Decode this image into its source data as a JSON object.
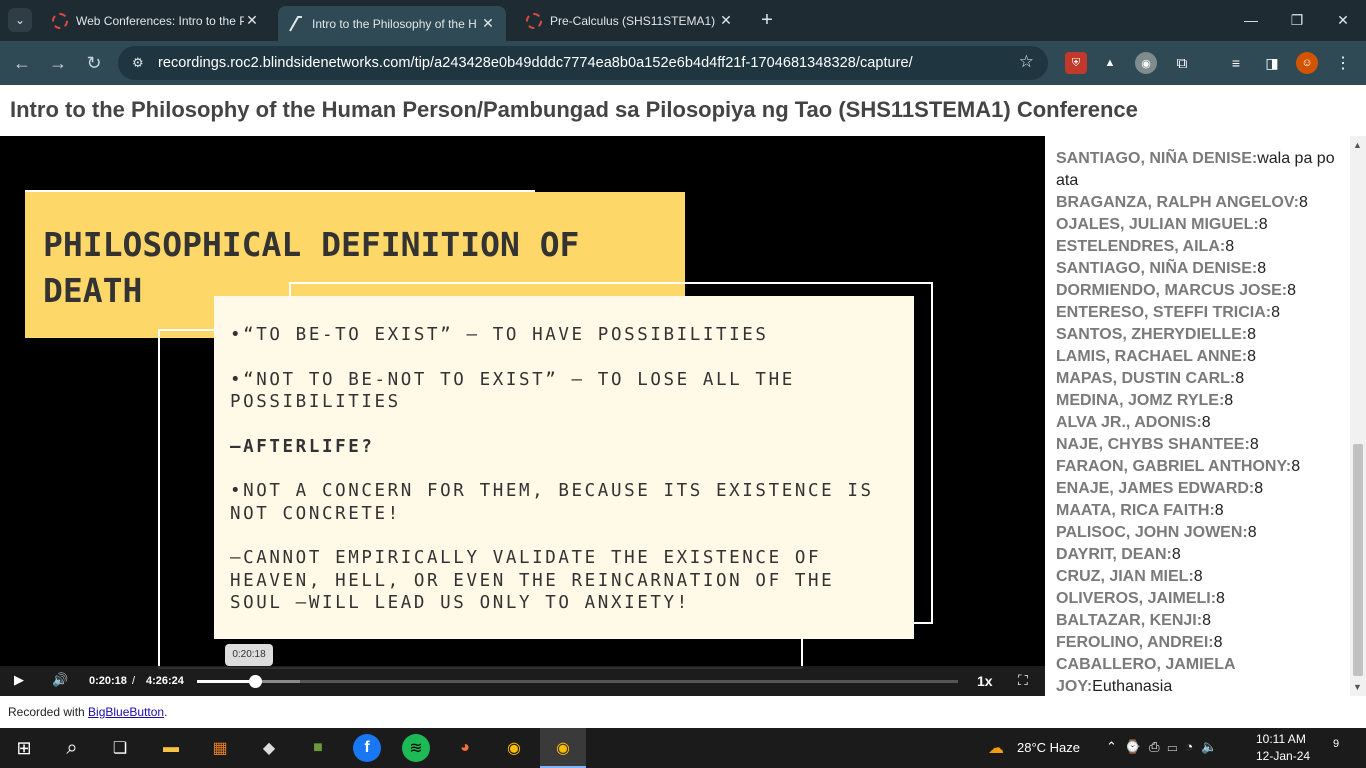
{
  "browser": {
    "tabs": [
      {
        "title": "Web Conferences: Intro to the P",
        "active": false
      },
      {
        "title": "Intro to the Philosophy of the H",
        "active": true
      },
      {
        "title": "Pre-Calculus (SHS11STEMA1)",
        "active": false
      }
    ],
    "url": "recordings.roc2.blindsidenetworks.com/tip/a243428e0b49dddc7774ea8b0a152e6b4d4ff21f-1704681348328/capture/"
  },
  "page": {
    "heading": "Intro to the Philosophy of the Human Person/Pambungad sa Pilosopiya ng Tao (SHS11STEMA1) Conference",
    "footer_prefix": "Recorded with ",
    "footer_link": "BigBlueButton",
    "footer_suffix": "."
  },
  "slide": {
    "title": "PHILOSOPHICAL DEFINITION OF DEATH",
    "lines": [
      "•“TO BE-TO EXIST” – TO HAVE POSSIBILITIES",
      "•“NOT TO BE-NOT TO EXIST” – TO LOSE ALL THE POSSIBILITIES",
      "–AFTERLIFE?",
      "•NOT A CONCERN FOR THEM, BECAUSE ITS EXISTENCE IS NOT CONCRETE!",
      "–CANNOT EMPIRICALLY VALIDATE THE EXISTENCE OF HEAVEN, HELL, OR EVEN THE REINCARNATION OF THE SOUL –WILL LEAD US ONLY TO ANXIETY!"
    ]
  },
  "player": {
    "current_time": "0:20:18",
    "separator": "/",
    "total_time": "4:26:24",
    "tooltip_time": "0:20:18",
    "speed": "1x",
    "progress_fraction": 0.076
  },
  "chat": [
    {
      "name": "SANTIAGO, NIÑA DENISE:",
      "message": "wala pa po ata"
    },
    {
      "name": "BRAGANZA, RALPH ANGELOV:",
      "message": "8"
    },
    {
      "name": "OJALES, JULIAN MIGUEL:",
      "message": "8"
    },
    {
      "name": "ESTELENDRES, AILA:",
      "message": "8"
    },
    {
      "name": "SANTIAGO, NIÑA DENISE:",
      "message": "8"
    },
    {
      "name": "DORMIENDO, MARCUS JOSE:",
      "message": "8"
    },
    {
      "name": "ENTERESO, STEFFI TRICIA:",
      "message": "8"
    },
    {
      "name": "SANTOS, ZHERYDIELLE:",
      "message": "8"
    },
    {
      "name": "LAMIS, RACHAEL ANNE:",
      "message": "8"
    },
    {
      "name": "MAPAS, DUSTIN CARL:",
      "message": "8"
    },
    {
      "name": "MEDINA, JOMZ RYLE:",
      "message": "8"
    },
    {
      "name": "ALVA JR., ADONIS:",
      "message": "8"
    },
    {
      "name": "NAJE, CHYBS SHANTEE:",
      "message": "8"
    },
    {
      "name": "FARAON, GABRIEL ANTHONY:",
      "message": "8"
    },
    {
      "name": "ENAJE, JAMES EDWARD:",
      "message": "8"
    },
    {
      "name": "MAATA, RICA FAITH:",
      "message": "8"
    },
    {
      "name": "PALISOC, JOHN JOWEN:",
      "message": "8"
    },
    {
      "name": "DAYRIT, DEAN:",
      "message": "8"
    },
    {
      "name": "CRUZ, JIAN MIEL:",
      "message": "8"
    },
    {
      "name": "OLIVEROS, JAIMELI:",
      "message": "8"
    },
    {
      "name": "BALTAZAR, KENJI:",
      "message": "8"
    },
    {
      "name": "FEROLINO, ANDREI:",
      "message": "8"
    },
    {
      "name": "CABALLERO, JAMIELA JOY:",
      "message": "Euthanasia"
    }
  ],
  "taskbar": {
    "weather": "28°C  Haze",
    "time": "10:11 AM",
    "date": "12-Jan-24",
    "notifications": "9"
  },
  "colors": {
    "slide_accent": "#fdd768",
    "card_bg": "#fff9e8",
    "chat_name": "#7a7a7a"
  }
}
